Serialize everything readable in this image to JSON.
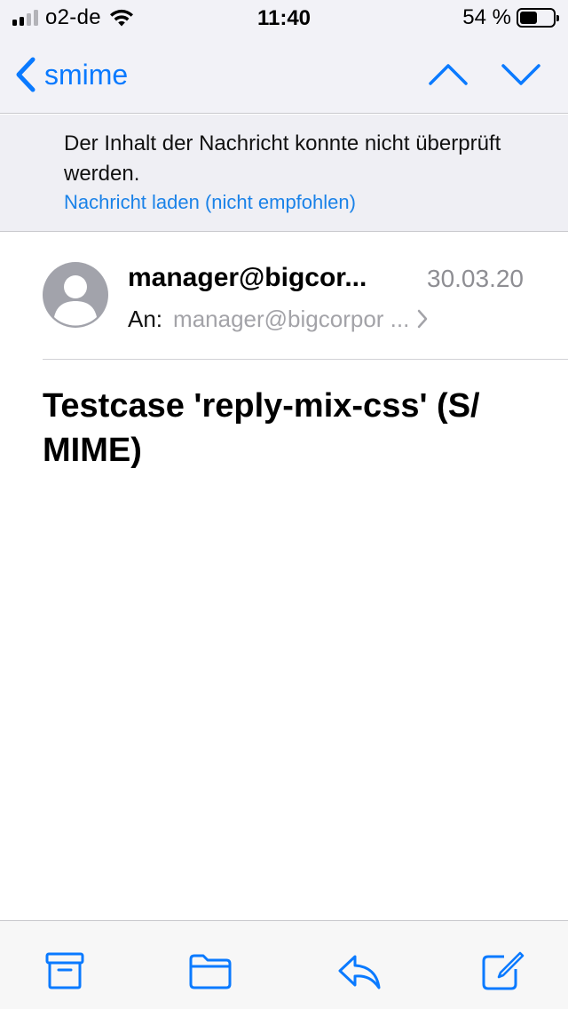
{
  "status_bar": {
    "carrier": "o2-de",
    "time": "11:40",
    "battery_percent": "54 %",
    "battery_level": 0.54,
    "signal_bars_active": 2,
    "signal_bars_total": 4
  },
  "nav": {
    "back_label": "smime",
    "icons": [
      "chevron-left-icon",
      "chevron-up-icon",
      "chevron-down-icon"
    ]
  },
  "banner": {
    "message": "Der Inhalt der Nachricht konnte nicht überprüft werden.",
    "link": "Nachricht laden (nicht empfohlen)"
  },
  "header": {
    "sender": "manager@bigcor...",
    "date": "30.03.20",
    "to_label": "An:",
    "recipient": "manager@bigcorpor ..."
  },
  "subject": "Testcase 'reply-mix-css' (S/ MIME)",
  "toolbar": {
    "icons": [
      "archive-icon",
      "folder-icon",
      "reply-icon",
      "compose-icon"
    ]
  },
  "colors": {
    "accent": "#0a7aff",
    "link": "#1a82e8",
    "secondary_text": "#8e8e93",
    "bar_background": "#f2f2f7",
    "avatar": "#a2a3ab"
  }
}
